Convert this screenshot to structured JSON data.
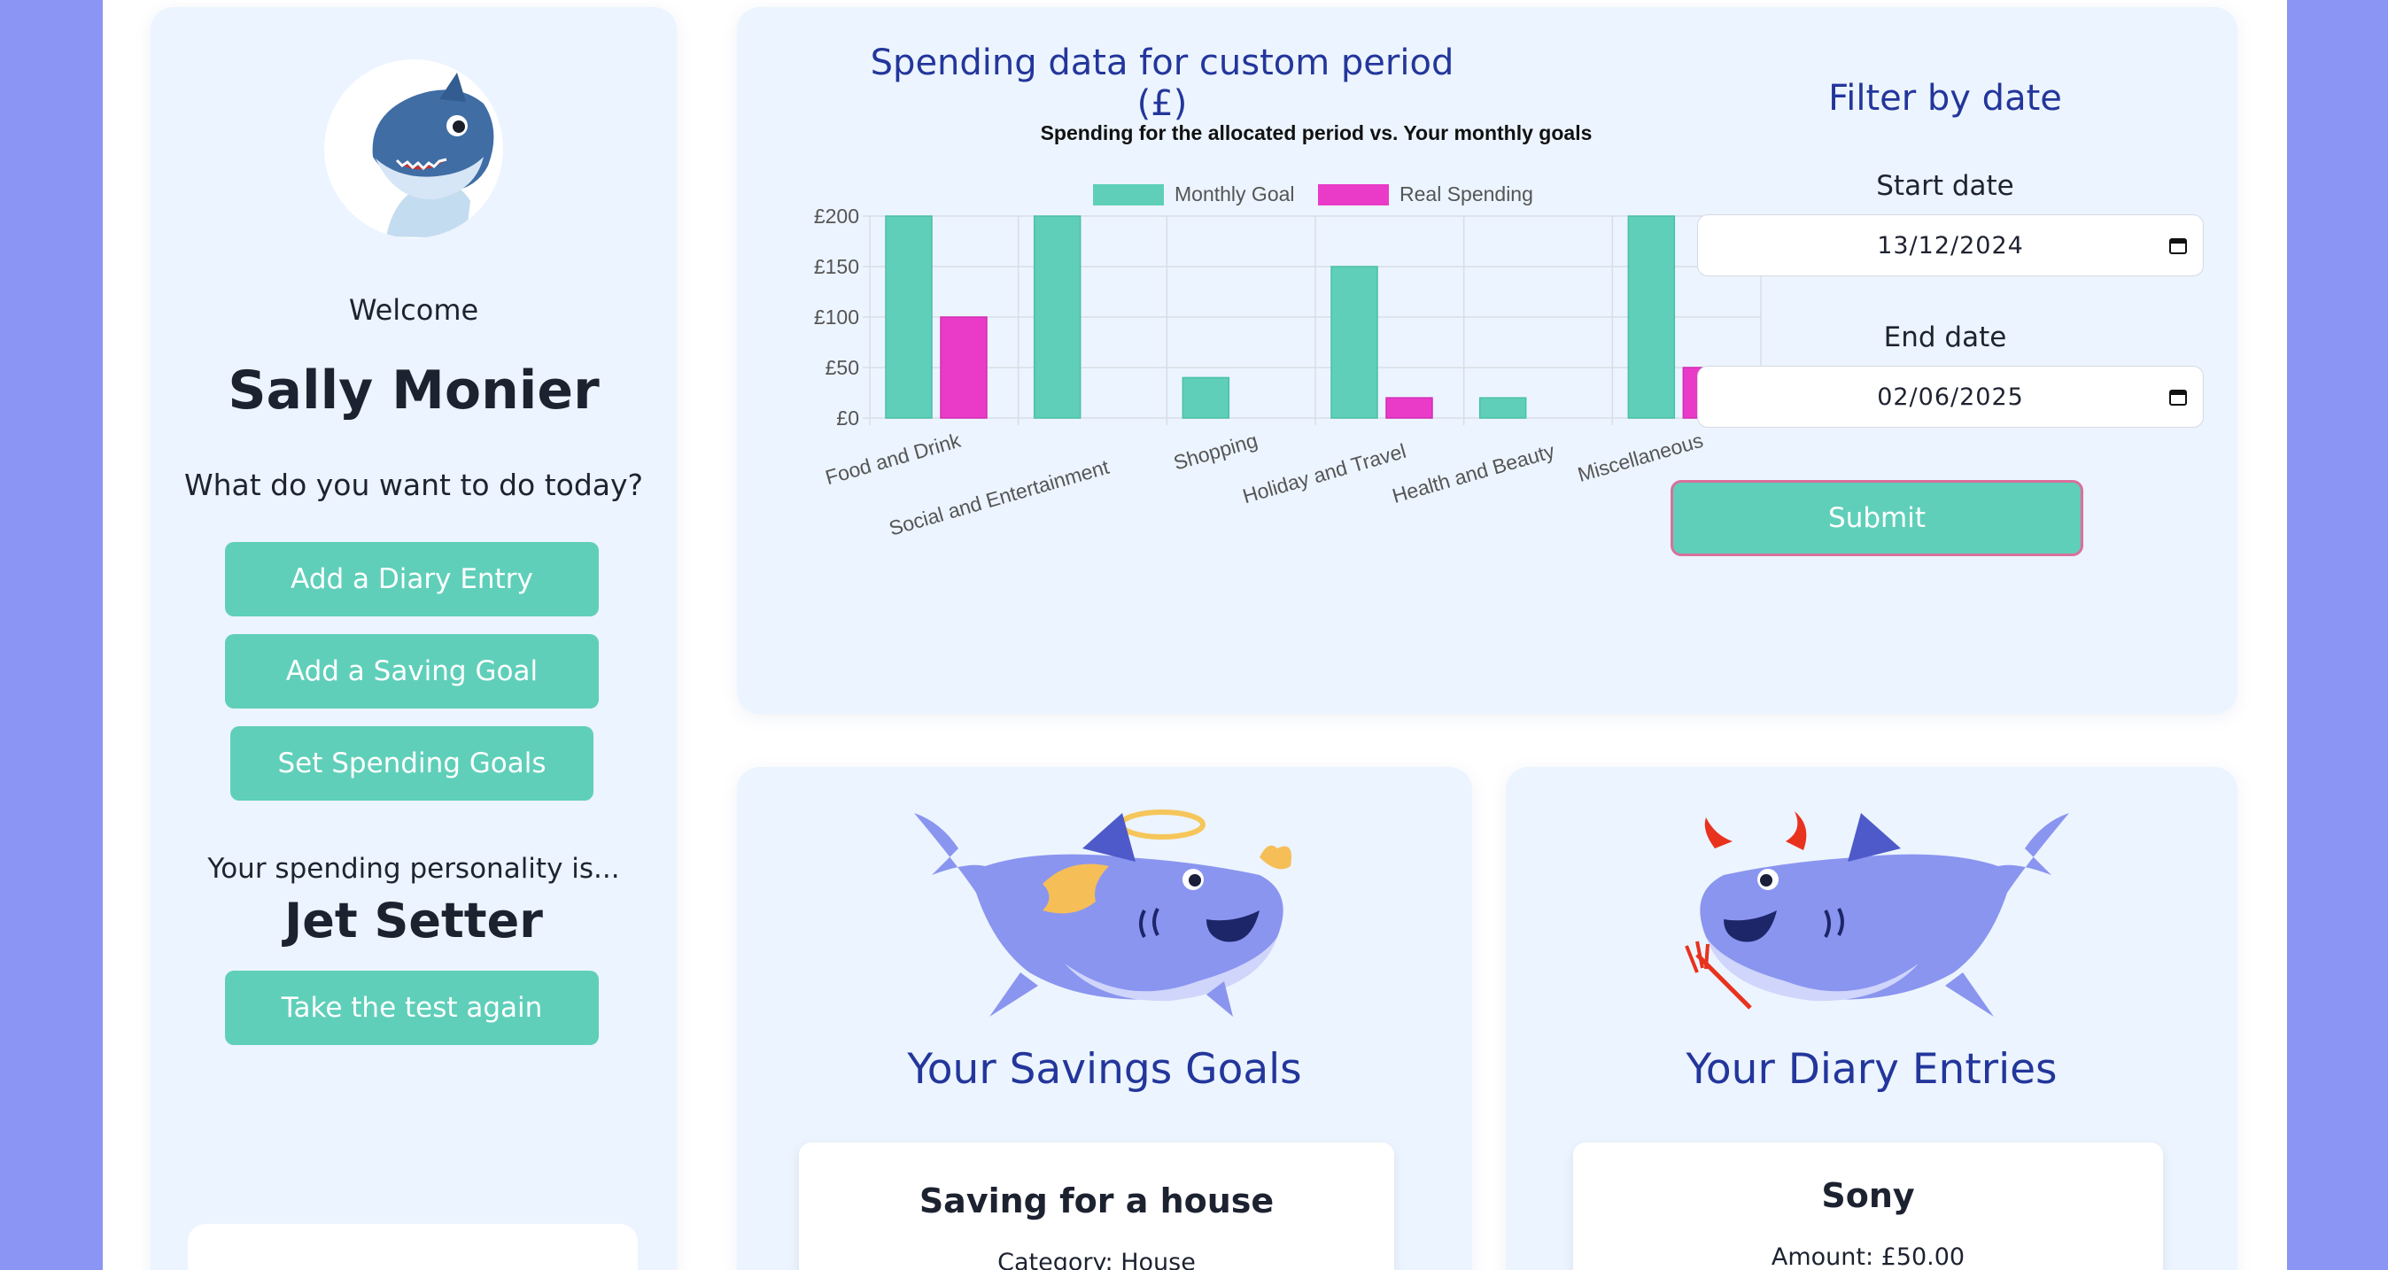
{
  "sidebar": {
    "welcome": "Welcome",
    "user_name": "Sally Monier",
    "question": "What do you want to do today?",
    "buttons": {
      "diary": "Add a Diary Entry",
      "saving": "Add a Saving Goal",
      "spending": "Set Spending Goals",
      "retake": "Take the test again"
    },
    "personality_label": "Your spending personality is...",
    "personality": "Jet Setter"
  },
  "chart_panel": {
    "heading": "Spending data for custom period (£)"
  },
  "chart_data": {
    "type": "bar",
    "title": "Spending for the allocated period vs. Your monthly goals",
    "categories": [
      "Food and Drink",
      "Social and Entertainment",
      "Shopping",
      "Holiday and Travel",
      "Health and Beauty",
      "Miscellaneous"
    ],
    "series": [
      {
        "name": "Monthly Goal",
        "color": "#5fcfb9",
        "values": [
          200,
          200,
          40,
          150,
          20,
          200
        ]
      },
      {
        "name": "Real Spending",
        "color": "#e93bc8",
        "values": [
          100,
          0,
          0,
          20,
          0,
          50
        ]
      }
    ],
    "ylim": [
      0,
      200
    ],
    "yticks": [
      "£0",
      "£50",
      "£100",
      "£150",
      "£200"
    ],
    "legend": "top",
    "grid": true
  },
  "filter": {
    "title": "Filter by date",
    "start_label": "Start date",
    "start_value": "13/12/2024",
    "end_label": "End date",
    "end_value": "02/06/2025",
    "submit": "Submit"
  },
  "goals": {
    "title": "Your Savings Goals",
    "first": {
      "name": "Saving for a house",
      "category": "Category:  House"
    }
  },
  "diary": {
    "title": "Your Diary Entries",
    "first": {
      "name": "Sony",
      "amount": "Amount: £50.00"
    }
  },
  "colors": {
    "accent": "#5fcfb9",
    "heading": "#23369b",
    "background": "#8b95f3"
  },
  "icons": [
    "shark-avatar-icon",
    "angel-shark-icon",
    "devil-shark-icon",
    "calendar-icon"
  ]
}
